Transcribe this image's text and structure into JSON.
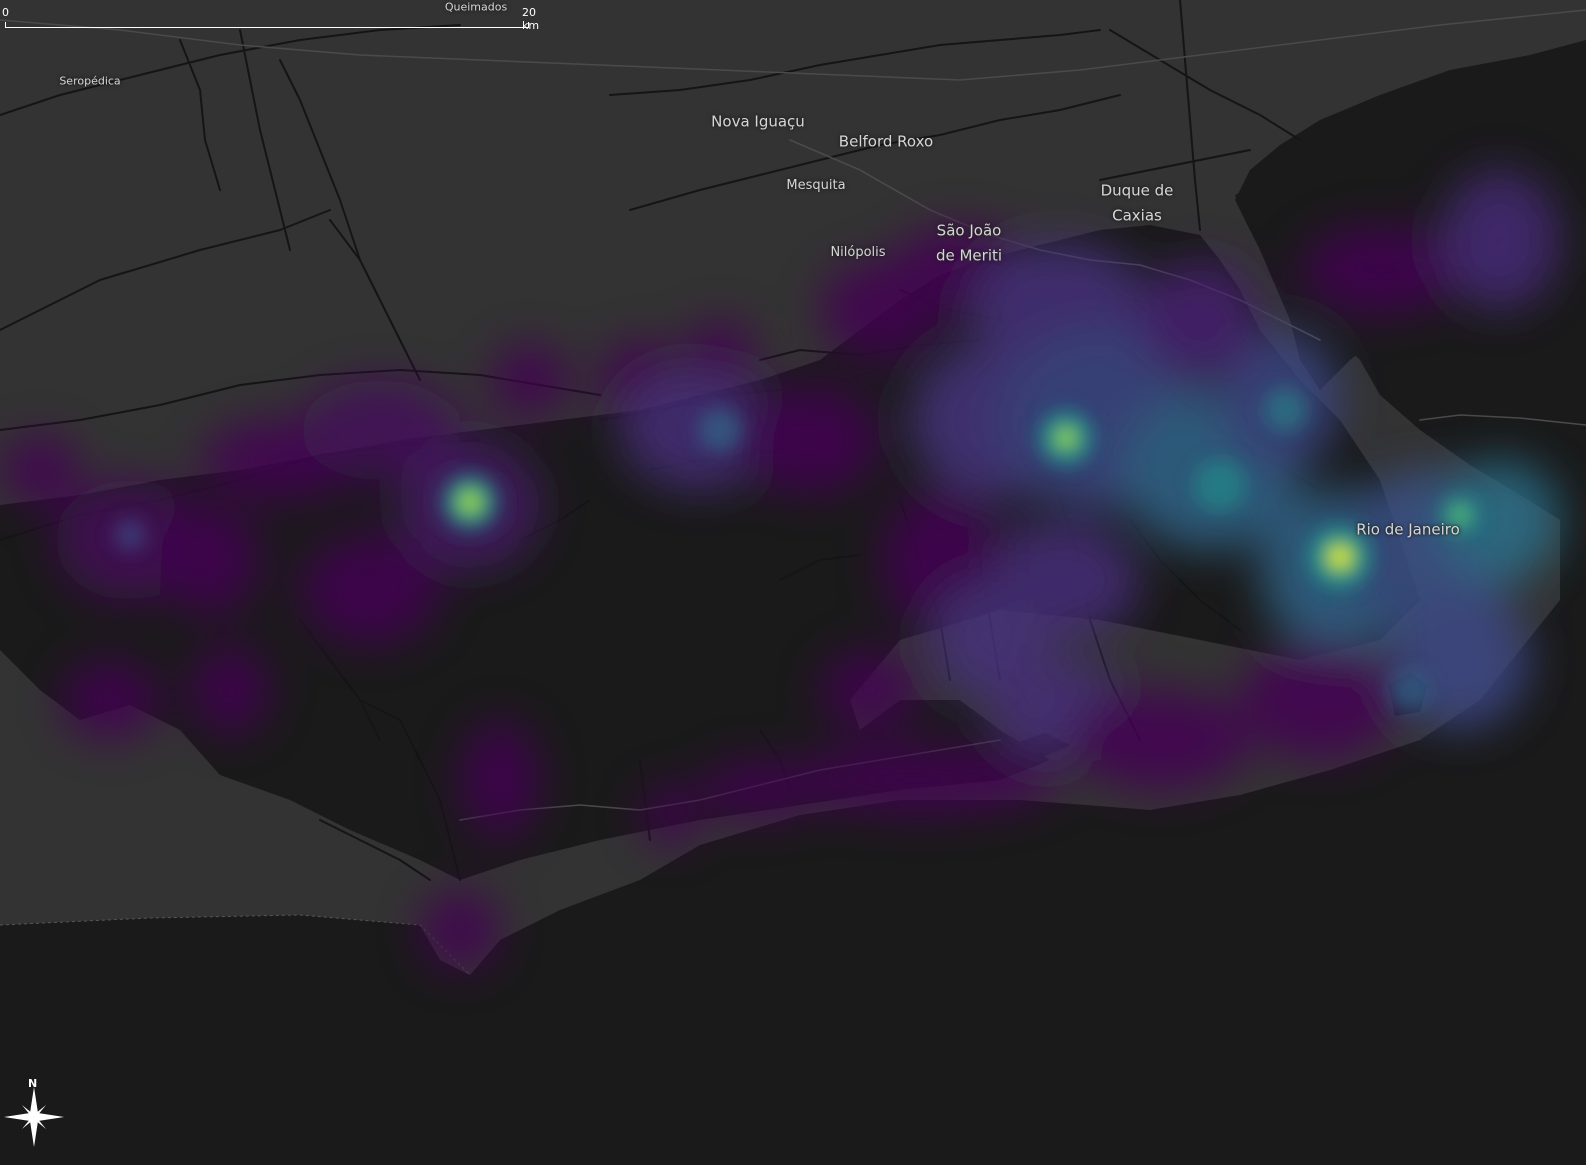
{
  "map": {
    "place_labels": [
      {
        "key": "queimados",
        "text": "Queimados"
      },
      {
        "key": "seropedica",
        "text": "Seropédica"
      },
      {
        "key": "nova_iguacu",
        "text": "Nova Iguaçu"
      },
      {
        "key": "belford_roxo",
        "text": "Belford Roxo"
      },
      {
        "key": "mesquita",
        "text": "Mesquita"
      },
      {
        "key": "nilopolis",
        "text": "Nilópolis"
      },
      {
        "key": "duque_de_caxias_1",
        "text": "Duque de"
      },
      {
        "key": "duque_de_caxias_2",
        "text": "Caxias"
      },
      {
        "key": "sao_joao_1",
        "text": "São João"
      },
      {
        "key": "sao_joao_2",
        "text": "de Meriti"
      },
      {
        "key": "rio_de_janeiro",
        "text": "Rio de Janeiro"
      }
    ],
    "scale_bar": {
      "start_label": "0",
      "end_label": "20 km"
    },
    "north_arrow": {
      "label": "N"
    },
    "colors": {
      "water": "#1a1a1a",
      "land": "#333333",
      "roads": "#151515",
      "heat_low": "#440154",
      "heat_mid": "#21918c",
      "heat_high": "#fde725"
    }
  }
}
